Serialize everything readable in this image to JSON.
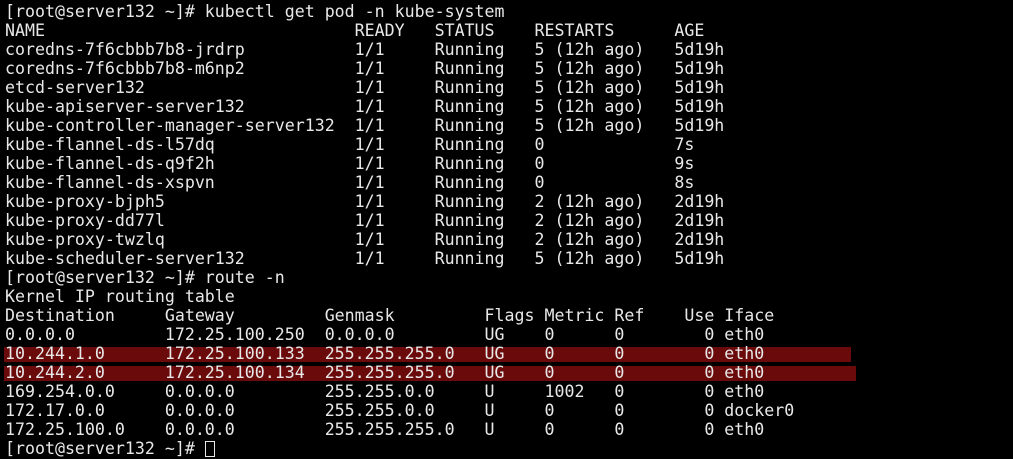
{
  "colors": {
    "background": "#000000",
    "text": "#e8e8e8",
    "highlight": "#6b0a0a"
  },
  "terminal": {
    "lines": [
      "[root@server132 ~]# kubectl get pod -n kube-system",
      "NAME                               READY   STATUS    RESTARTS      AGE",
      "coredns-7f6cbbb7b8-jrdrp           1/1     Running   5 (12h ago)   5d19h",
      "coredns-7f6cbbb7b8-m6np2           1/1     Running   5 (12h ago)   5d19h",
      "etcd-server132                     1/1     Running   5 (12h ago)   5d19h",
      "kube-apiserver-server132           1/1     Running   5 (12h ago)   5d19h",
      "kube-controller-manager-server132  1/1     Running   5 (12h ago)   5d19h",
      "kube-flannel-ds-l57dq              1/1     Running   0             7s",
      "kube-flannel-ds-q9f2h              1/1     Running   0             9s",
      "kube-flannel-ds-xspvn              1/1     Running   0             8s",
      "kube-proxy-bjph5                   1/1     Running   2 (12h ago)   2d19h",
      "kube-proxy-dd77l                   1/1     Running   2 (12h ago)   2d19h",
      "kube-proxy-twzlq                   1/1     Running   2 (12h ago)   2d19h",
      "kube-scheduler-server132           1/1     Running   5 (12h ago)   5d19h",
      "[root@server132 ~]# route -n",
      "Kernel IP routing table",
      "Destination     Gateway         Genmask         Flags Metric Ref    Use Iface",
      "0.0.0.0         172.25.100.250  0.0.0.0         UG    0      0        0 eth0",
      "10.244.1.0      172.25.100.133  255.255.255.0   UG    0      0        0 eth0",
      "10.244.2.0      172.25.100.134  255.255.255.0   UG    0      0        0 eth0",
      "169.254.0.0     0.0.0.0         255.255.0.0     U     1002   0        0 eth0",
      "172.17.0.0      0.0.0.0         255.255.0.0     U     0      0        0 docker0",
      "172.25.100.0    0.0.0.0         255.255.255.0   U     0      0        0 eth0"
    ],
    "prompt": "[root@server132 ~]# "
  }
}
